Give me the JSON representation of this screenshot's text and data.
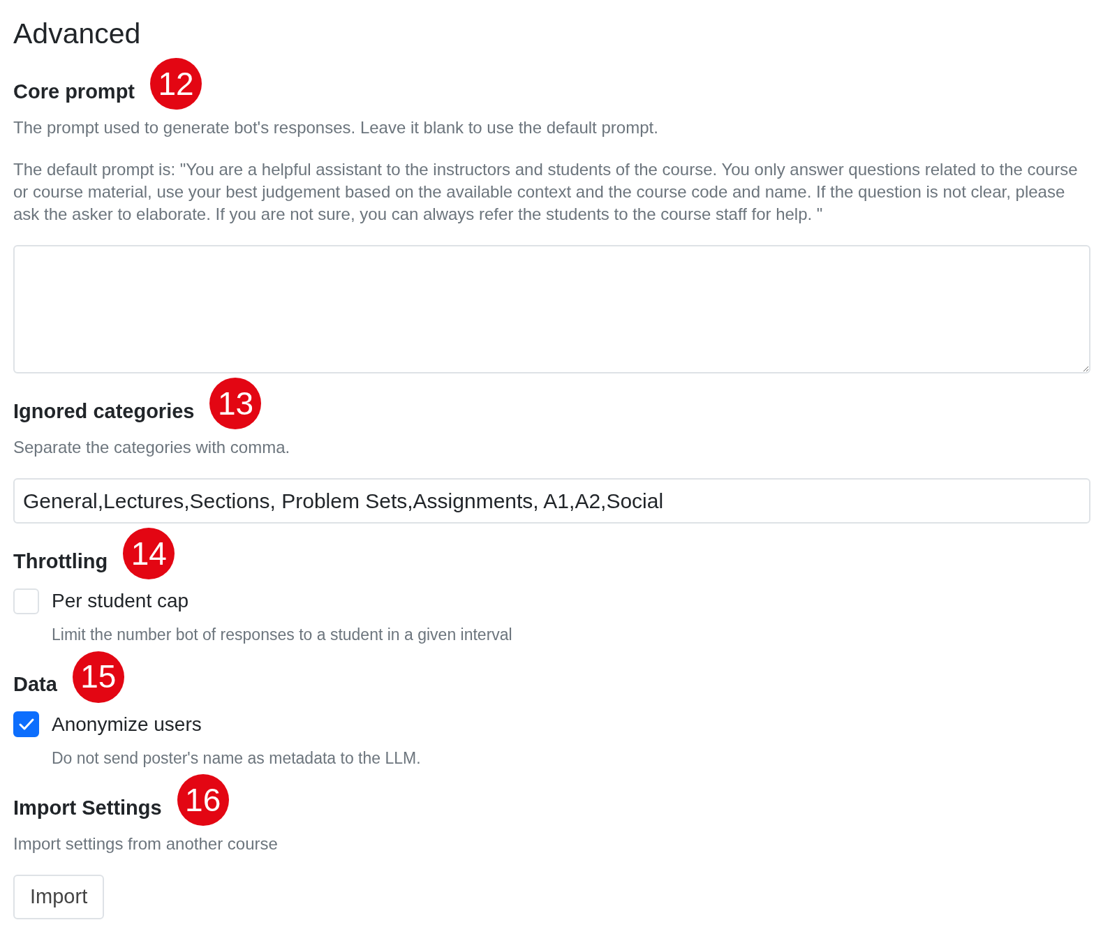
{
  "title": "Advanced",
  "sections": [
    {
      "kind": "textarea",
      "heading": "Core prompt",
      "callout": "12",
      "descriptions": [
        "The prompt used to generate bot's responses. Leave it blank to use the default prompt.",
        "The default prompt is: \"You are a helpful assistant to the instructors and students of the course. You only answer questions related to the course or course material, use your best judgement based on the available context and the course code and name. If the question is not clear, please ask the asker to elaborate. If you are not sure, you can always refer the students to the course staff for help. \""
      ]
    },
    {
      "kind": "input",
      "heading": "Ignored categories",
      "callout": "13",
      "descriptions": [
        "Separate the categories with comma."
      ],
      "value": "General,Lectures,Sections, Problem Sets,Assignments, A1,A2,Social"
    },
    {
      "kind": "checkbox",
      "heading": "Throttling",
      "callout": "14",
      "label": "Per student cap",
      "checked": false,
      "help": "Limit the number bot of responses to a student in a given interval"
    },
    {
      "kind": "checkbox",
      "heading": "Data",
      "callout": "15",
      "label": "Anonymize users",
      "checked": true,
      "help": "Do not send poster's name as metadata to the LLM."
    },
    {
      "kind": "button",
      "heading": "Import Settings",
      "callout": "16",
      "descriptions": [
        "Import settings from another course"
      ],
      "button": "Import"
    }
  ]
}
